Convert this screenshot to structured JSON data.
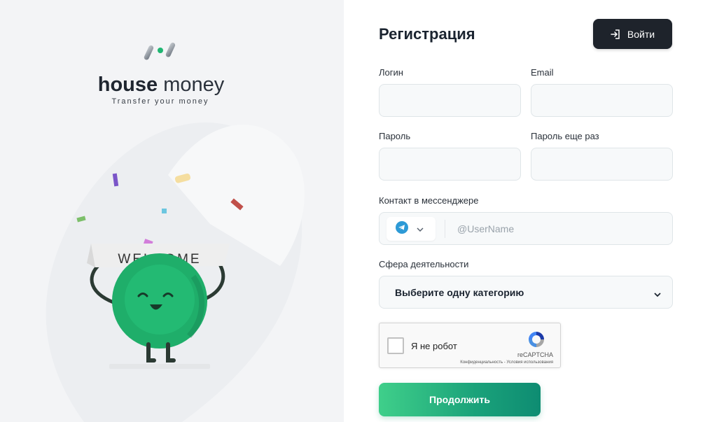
{
  "brand": {
    "name_bold": "house",
    "name_light": "money",
    "tagline": "Transfer your money",
    "welcome_banner": "WELCOME"
  },
  "header": {
    "title": "Регистрация",
    "login_button": "Войти"
  },
  "form": {
    "login_label": "Логин",
    "email_label": "Email",
    "password_label": "Пароль",
    "password_repeat_label": "Пароль еще раз",
    "messenger_label": "Контакт в мессенджере",
    "messenger_icon": "telegram-icon",
    "messenger_placeholder": "@UserName",
    "activity_label": "Сфера деятельности",
    "activity_value": "Выберите одну категорию",
    "continue_button": "Продолжить"
  },
  "captcha": {
    "label": "Я не робот",
    "brand": "reCAPTCHA",
    "terms": "Конфиденциальность - Условия использования"
  },
  "colors": {
    "accent_green": "#1aa27a",
    "dark_button": "#1e232b",
    "telegram_blue": "#2d9ad6"
  }
}
